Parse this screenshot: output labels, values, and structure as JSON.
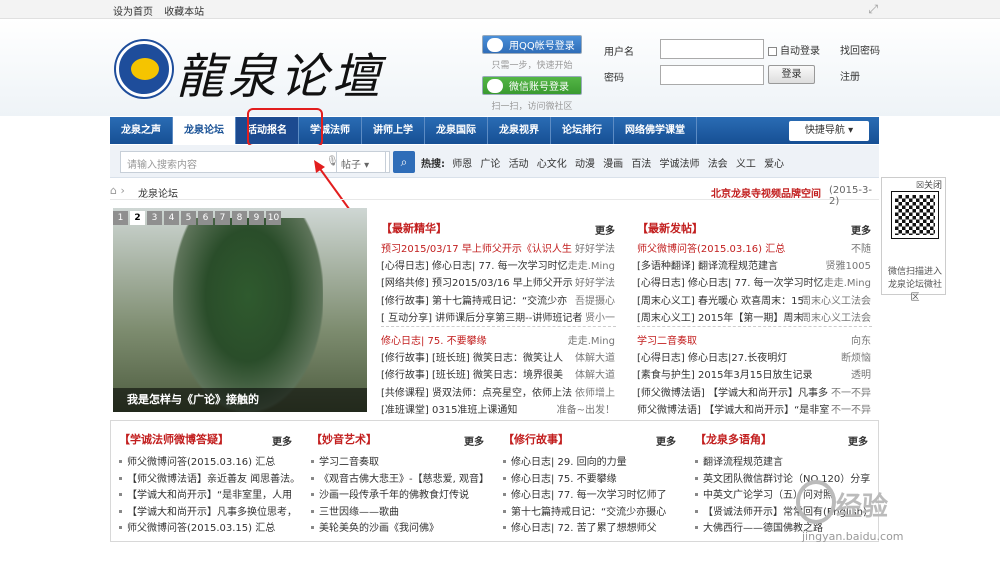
{
  "topbar": {
    "set_home": "设为首页",
    "favorite": "收藏本站"
  },
  "logo": {
    "text": "龍泉论壇"
  },
  "social": {
    "qq_label": "用QQ帐号登录",
    "qq_hint": "只需一步，快速开始",
    "wx_label": "微信账号登录",
    "wx_hint": "扫一扫，访问微社区"
  },
  "login": {
    "username_label": "用户名",
    "password_label": "密码",
    "auto_login": "自动登录",
    "find_password": "找回密码",
    "login_button": "登录",
    "register": "注册"
  },
  "nav": {
    "items": [
      "龙泉之声",
      "龙泉论坛",
      "活动报名",
      "学诚法师",
      "讲师上学",
      "龙泉国际",
      "龙泉视界",
      "论坛排行",
      "网络佛学课堂"
    ],
    "active_index": 1,
    "highlight_index": 2,
    "quick": "快捷导航"
  },
  "search": {
    "placeholder": "请输入搜索内容",
    "scope": "帖子",
    "hot_label": "热搜:",
    "hot": [
      "师恩",
      "广论",
      "活动",
      "心文化",
      "动漫",
      "漫画",
      "百法",
      "学诚法师",
      "法会",
      "义工",
      "爱心"
    ]
  },
  "crumb": {
    "text": "龙泉论坛",
    "right": "北京龙泉寺视频品牌空间",
    "date": "(2015-3-2)"
  },
  "qr": {
    "close": "关闭",
    "caption": "微信扫描进入龙泉论坛微社区"
  },
  "slider": {
    "pages": [
      "1",
      "2",
      "3",
      "4",
      "5",
      "6",
      "7",
      "8",
      "9",
      "10"
    ],
    "current": "2",
    "caption": "我是怎样与《广论》接触的"
  },
  "latest": {
    "title": "【最新精华】",
    "more": "更多",
    "items": [
      {
        "t": "预习2015/03/17 早上师父开示《认识人生",
        "a": "好好学法",
        "red": true
      },
      {
        "t": "[心得日志] 修心日志| 77. 每一次学习时忆",
        "a": "走走.Ming"
      },
      {
        "t": "[网络共修] 预习2015/03/16 早上师父开示",
        "a": "好好学法"
      },
      {
        "t": "[修行故事] 第十七篇持戒日记：“交流少亦",
        "a": "吾提摄心"
      },
      {
        "t": "[ 互动分享] 讲师课后分享第三期--讲师班记者",
        "a": "贤小一"
      },
      {
        "t": "修心日志| 75. 不要攀缘",
        "a": "走走.Ming",
        "red": true
      },
      {
        "t": "[修行故事] [班长班] 微笑日志：微笑让人",
        "a": "体解大道"
      },
      {
        "t": "[修行故事] [班长班] 微笑日志：境界很美",
        "a": "体解大道"
      },
      {
        "t": "[共修课程] 贤双法师：点亮星空，依师上法",
        "a": "依师增上"
      },
      {
        "t": "[准班课堂] 0315准班上课通知",
        "a": "准备~出发！"
      }
    ]
  },
  "newest": {
    "title": "【最新发帖】",
    "more": "更多",
    "items": [
      {
        "t": "师父微博问答(2015.03.16) 汇总",
        "a": "不随",
        "red": true
      },
      {
        "t": "[多语种翻译] 翻译流程规范建言",
        "a": "贤雅1005"
      },
      {
        "t": "[心得日志] 修心日志| 77. 每一次学习时忆",
        "a": "走走.Ming"
      },
      {
        "t": "[周末心义工] 春光暖心 欢喜周末：15",
        "a": "周末心义工法会"
      },
      {
        "t": "[周末心义工] 2015年【第一期】周末",
        "a": "周末心义工法会"
      },
      {
        "t": "学习二音奏取",
        "a": "向东",
        "red": true
      },
      {
        "t": "[心得日志] 修心日志|27.长夜明灯",
        "a": "断烦恼"
      },
      {
        "t": "[素食与护生] 2015年3月15日放生记录",
        "a": "透明"
      },
      {
        "t": "[师父微博法语] 【学诚大和尚开示】凡事多",
        "a": "不一不异"
      },
      {
        "t": "师父微博法语] 【学诚大和尚开示】“是非室",
        "a": "不一不异"
      }
    ]
  },
  "sections": [
    {
      "title": "【学诚法师微博答疑】",
      "more": "更多",
      "items": [
        "师父微博问答(2015.03.16) 汇总",
        "【师父微博法语】亲近善友 闻思善法。",
        "【学诚大和尚开示】“是非室里，人用",
        "【学诚大和尚开示】凡事多换位思考，",
        "师父微博问答(2015.03.15) 汇总"
      ]
    },
    {
      "title": "【妙音艺术】",
      "more": "更多",
      "items": [
        "学习二音奏取",
        "《观音古佛大悲王》-【慈悲爱, 观音】",
        "沙画一段传承千年的佛教食灯传说",
        "三世因缘——歌曲",
        "美轮美奂的沙画《我问佛》"
      ]
    },
    {
      "title": "【修行故事】",
      "more": "更多",
      "items": [
        "修心日志| 29. 回向的力量",
        "修心日志| 75. 不要攀缘",
        "修心日志| 77. 每一次学习时忆师了",
        "第十七篇持戒日记：“交流少亦摄心",
        "修心日志| 72. 苦了累了想想师父"
      ]
    },
    {
      "title": "【龙泉多语角】",
      "more": "更多",
      "items": [
        "翻译流程规范建言",
        "英文团队微信群讨论（NO.120）分享",
        "中英文广论学习（五）问对照",
        "【贤诚法师开示】常常回有(English)",
        "大佛西行——德国佛教之路"
      ]
    }
  ],
  "watermark": {
    "text": "经验",
    "url": "jingyan.baidu.com"
  }
}
